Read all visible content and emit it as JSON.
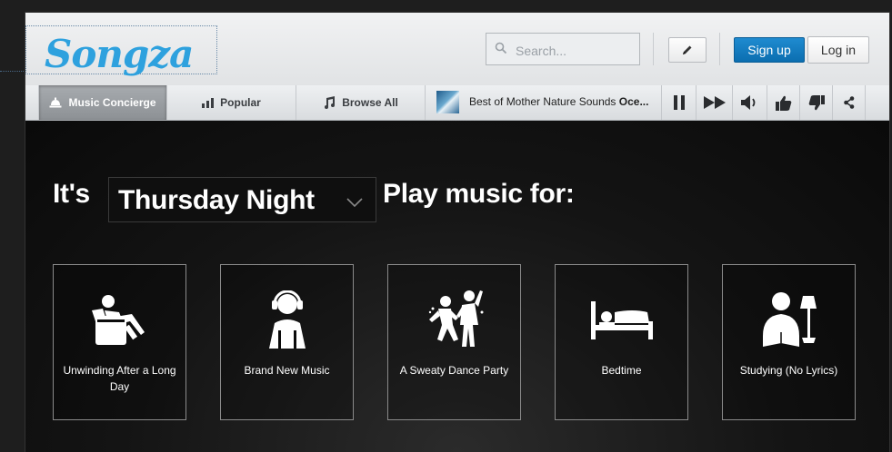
{
  "header": {
    "logo_text": "Songza",
    "search": {
      "placeholder": "Search..."
    },
    "signup_label": "Sign up",
    "login_label": "Log in"
  },
  "nav": {
    "tabs": [
      {
        "label": "Music Concierge",
        "icon": "bell-icon",
        "active": true
      },
      {
        "label": "Popular",
        "icon": "bar-chart-icon",
        "active": false
      },
      {
        "label": "Browse All",
        "icon": "music-note-icon",
        "active": false
      }
    ],
    "now_playing": {
      "title": "Best of Mother Nature Sounds ",
      "artist": "Oce..."
    },
    "controls": [
      "pause-icon",
      "fast-forward-icon",
      "volume-icon",
      "thumbs-up-icon",
      "thumbs-down-icon",
      "share-icon"
    ]
  },
  "concierge": {
    "prefix": "It's",
    "selected_day": "Thursday Night",
    "suffix": "Play music for:",
    "cards": [
      {
        "label": "Unwinding After a Long Day",
        "icon": "recliner-icon"
      },
      {
        "label": "Brand New Music",
        "icon": "headphones-person-icon"
      },
      {
        "label": "A Sweaty Dance Party",
        "icon": "dancers-icon"
      },
      {
        "label": "Bedtime",
        "icon": "bed-icon"
      },
      {
        "label": "Studying (No Lyrics)",
        "icon": "studying-icon"
      }
    ]
  },
  "colors": {
    "brand_blue": "#2ea1de",
    "signup_blue": "#1478bd",
    "background": "#0d0d0d"
  }
}
